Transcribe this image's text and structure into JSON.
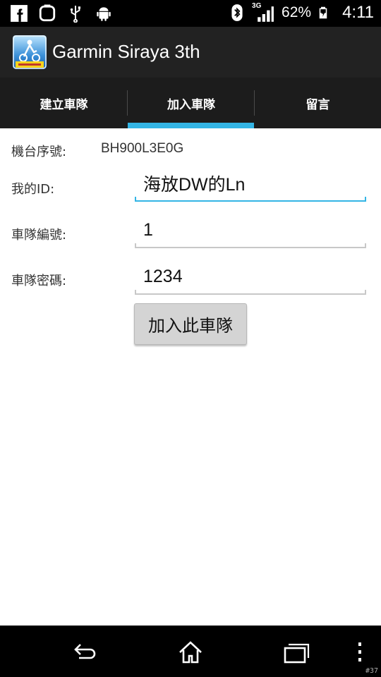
{
  "status_bar": {
    "network_type": "3G",
    "battery_percent": "62%",
    "time": "4:11",
    "icons": [
      "facebook-icon",
      "square-app-icon",
      "usb-icon",
      "android-debug-icon",
      "bluetooth-icon",
      "signal-icon",
      "battery-charging-icon"
    ]
  },
  "app": {
    "title": "Garmin Siraya 3th",
    "icon": "app-logo-icon"
  },
  "tabs": [
    {
      "label": "建立車隊",
      "selected": false
    },
    {
      "label": "加入車隊",
      "selected": true
    },
    {
      "label": "留言",
      "selected": false
    }
  ],
  "form": {
    "device_serial_label": "機台序號:",
    "device_serial_value": "BH900L3E0G",
    "my_id_label": "我的ID:",
    "my_id_value": "海放DW的Ln",
    "team_number_label": "車隊編號:",
    "team_number_value": "1",
    "team_password_label": "車隊密碼:",
    "team_password_value": "1234",
    "join_button_label": "加入此車隊"
  },
  "nav_bar": {
    "icons": [
      "back-icon",
      "home-icon",
      "recent-apps-icon",
      "overflow-menu-icon"
    ]
  },
  "corner_mark": "#37",
  "colors": {
    "accent": "#33b5e5",
    "action_bar": "#222222",
    "tab_bar": "#1c1c1c"
  }
}
